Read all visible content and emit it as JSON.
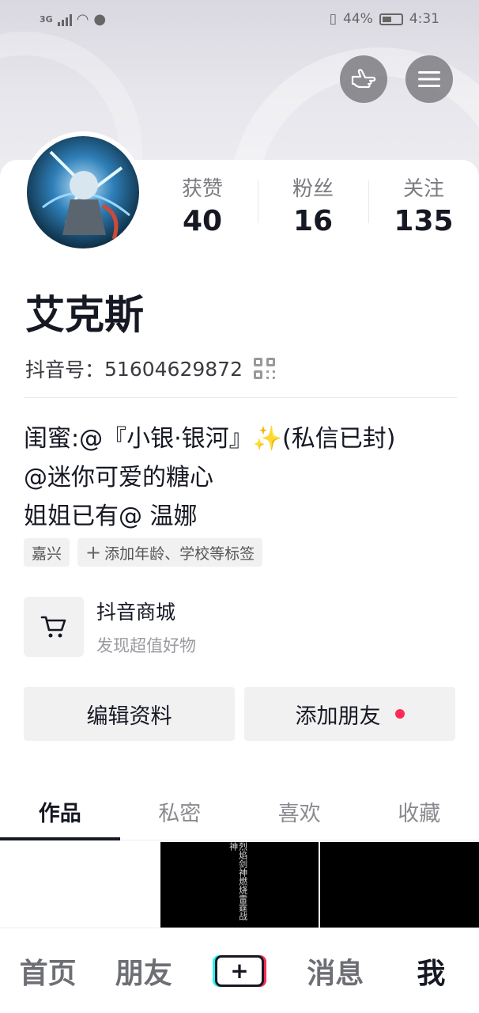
{
  "status_bar": {
    "network": "3G",
    "battery": "44%",
    "time": "4:31"
  },
  "stats": [
    {
      "label": "获赞",
      "value": "40"
    },
    {
      "label": "粉丝",
      "value": "16"
    },
    {
      "label": "关注",
      "value": "135"
    }
  ],
  "profile": {
    "nickname": "艾克斯",
    "douyin_id_label": "抖音号：",
    "douyin_id": "51604629872"
  },
  "bio": [
    "闺蜜:@『小银·银河』✨(私信已封)",
    "@迷你可爱的糖心",
    "姐姐已有@ 温娜"
  ],
  "tags": [
    {
      "label": "嘉兴"
    },
    {
      "label": "添加年龄、学校等标签",
      "prefix": "+"
    }
  ],
  "mall": {
    "title": "抖音商城",
    "subtitle": "发现超值好物"
  },
  "actions": {
    "edit": "编辑资料",
    "add_friend": "添加朋友"
  },
  "tabs": [
    "作品",
    "私密",
    "喜欢",
    "收藏"
  ],
  "active_tab": "作品",
  "grid_text": "烈焰剑神燃烧雷霆战神",
  "bottom_nav": [
    "首页",
    "朋友",
    "+",
    "消息",
    "我"
  ],
  "colors": {
    "accent_red": "#fe2c55",
    "text_primary": "#161823",
    "text_secondary": "#8a8b90"
  },
  "icons": {
    "gesture": "hand-pointing-icon",
    "menu": "hamburger-menu-icon",
    "cart": "shopping-cart-icon",
    "qr": "qr-code-icon"
  }
}
